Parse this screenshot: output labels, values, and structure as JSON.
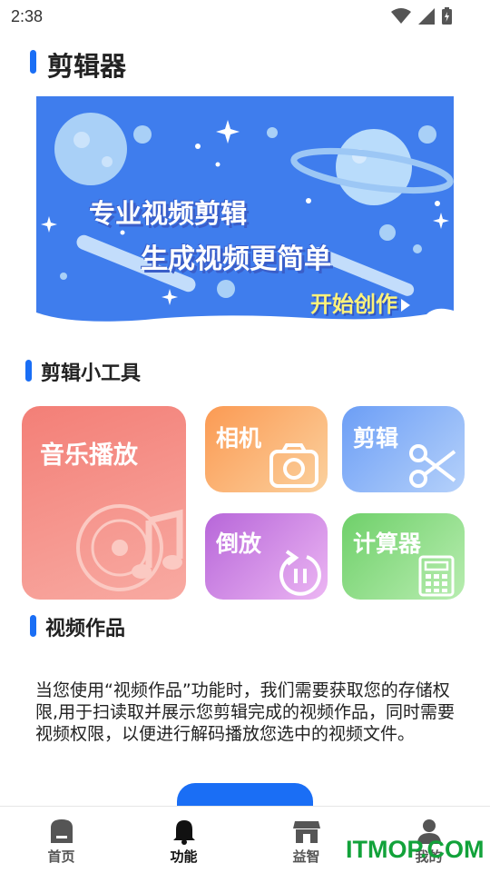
{
  "status_bar": {
    "time": "2:38"
  },
  "page": {
    "title": "剪辑器"
  },
  "banner": {
    "line1": "专业视频剪辑",
    "line2": "生成视频更简单",
    "cta": "开始创作"
  },
  "tools_section": {
    "title": "剪辑小工具",
    "items": [
      {
        "label": "音乐播放",
        "icon": "music-disc-icon"
      },
      {
        "label": "相机",
        "icon": "camera-icon"
      },
      {
        "label": "剪辑",
        "icon": "scissors-icon"
      },
      {
        "label": "倒放",
        "icon": "replay-icon"
      },
      {
        "label": "计算器",
        "icon": "calculator-icon"
      }
    ]
  },
  "works_section": {
    "title": "视频作品",
    "notice": "当您使用“视频作品”功能时，我们需要获取您的存储权限,用于扫读取并展示您剪辑完成的视频作品，同时需要视频权限，以便进行解码播放您选中的视频文件。"
  },
  "bottom_nav": {
    "items": [
      {
        "label": "首页",
        "icon": "home-icon",
        "active": false
      },
      {
        "label": "功能",
        "icon": "bell-icon",
        "active": true
      },
      {
        "label": "益智",
        "icon": "store-icon",
        "active": false
      },
      {
        "label": "我的",
        "icon": "person-icon",
        "active": false
      }
    ]
  },
  "watermark": "ITMOP.COM",
  "colors": {
    "accent": "#1a6ef5",
    "banner_bg": "#3f7ded"
  }
}
